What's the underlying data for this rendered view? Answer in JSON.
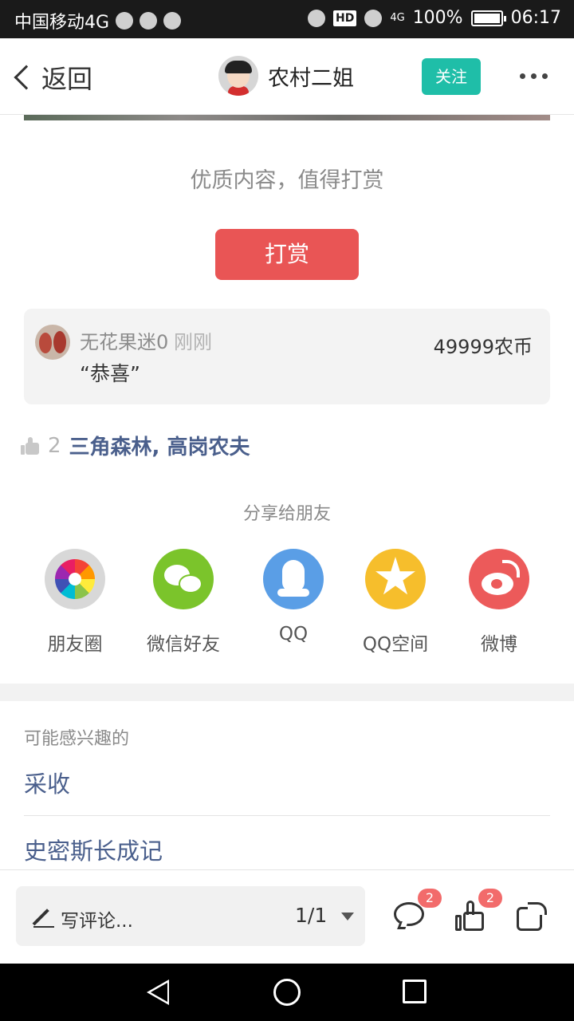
{
  "status_bar": {
    "carrier": "中国移动4G",
    "hd_label": "HD",
    "network": "4G",
    "battery": "100%",
    "time": "06:17"
  },
  "nav": {
    "back_label": "返回",
    "user_name": "农村二姐",
    "follow_label": "关注"
  },
  "reward": {
    "prompt": "优质内容，值得打赏",
    "button_label": "打赏"
  },
  "reward_record": {
    "user": "无花果迷0",
    "time": "刚刚",
    "message": "“恭喜”",
    "amount": "49999农币"
  },
  "likes": {
    "count": "2",
    "names": "三角森林, 高岗农夫"
  },
  "share": {
    "title": "分享给朋友",
    "items": [
      {
        "label": "朋友圈",
        "icon": "moments-icon"
      },
      {
        "label": "微信好友",
        "icon": "wechat-icon"
      },
      {
        "label": "QQ",
        "icon": "qq-icon"
      },
      {
        "label": "QQ空间",
        "icon": "qzone-icon"
      },
      {
        "label": "微博",
        "icon": "weibo-icon"
      }
    ]
  },
  "interest": {
    "title": "可能感兴趣的",
    "items": [
      "采收",
      "史密斯长成记"
    ]
  },
  "bottom": {
    "comment_placeholder": "写评论...",
    "page_indicator": "1/1",
    "comment_badge": "2",
    "like_badge": "2"
  },
  "colors": {
    "accent": "#1fbea8",
    "reward": "#e95555",
    "link": "#4a5f8c",
    "badge": "#f26b6b"
  }
}
